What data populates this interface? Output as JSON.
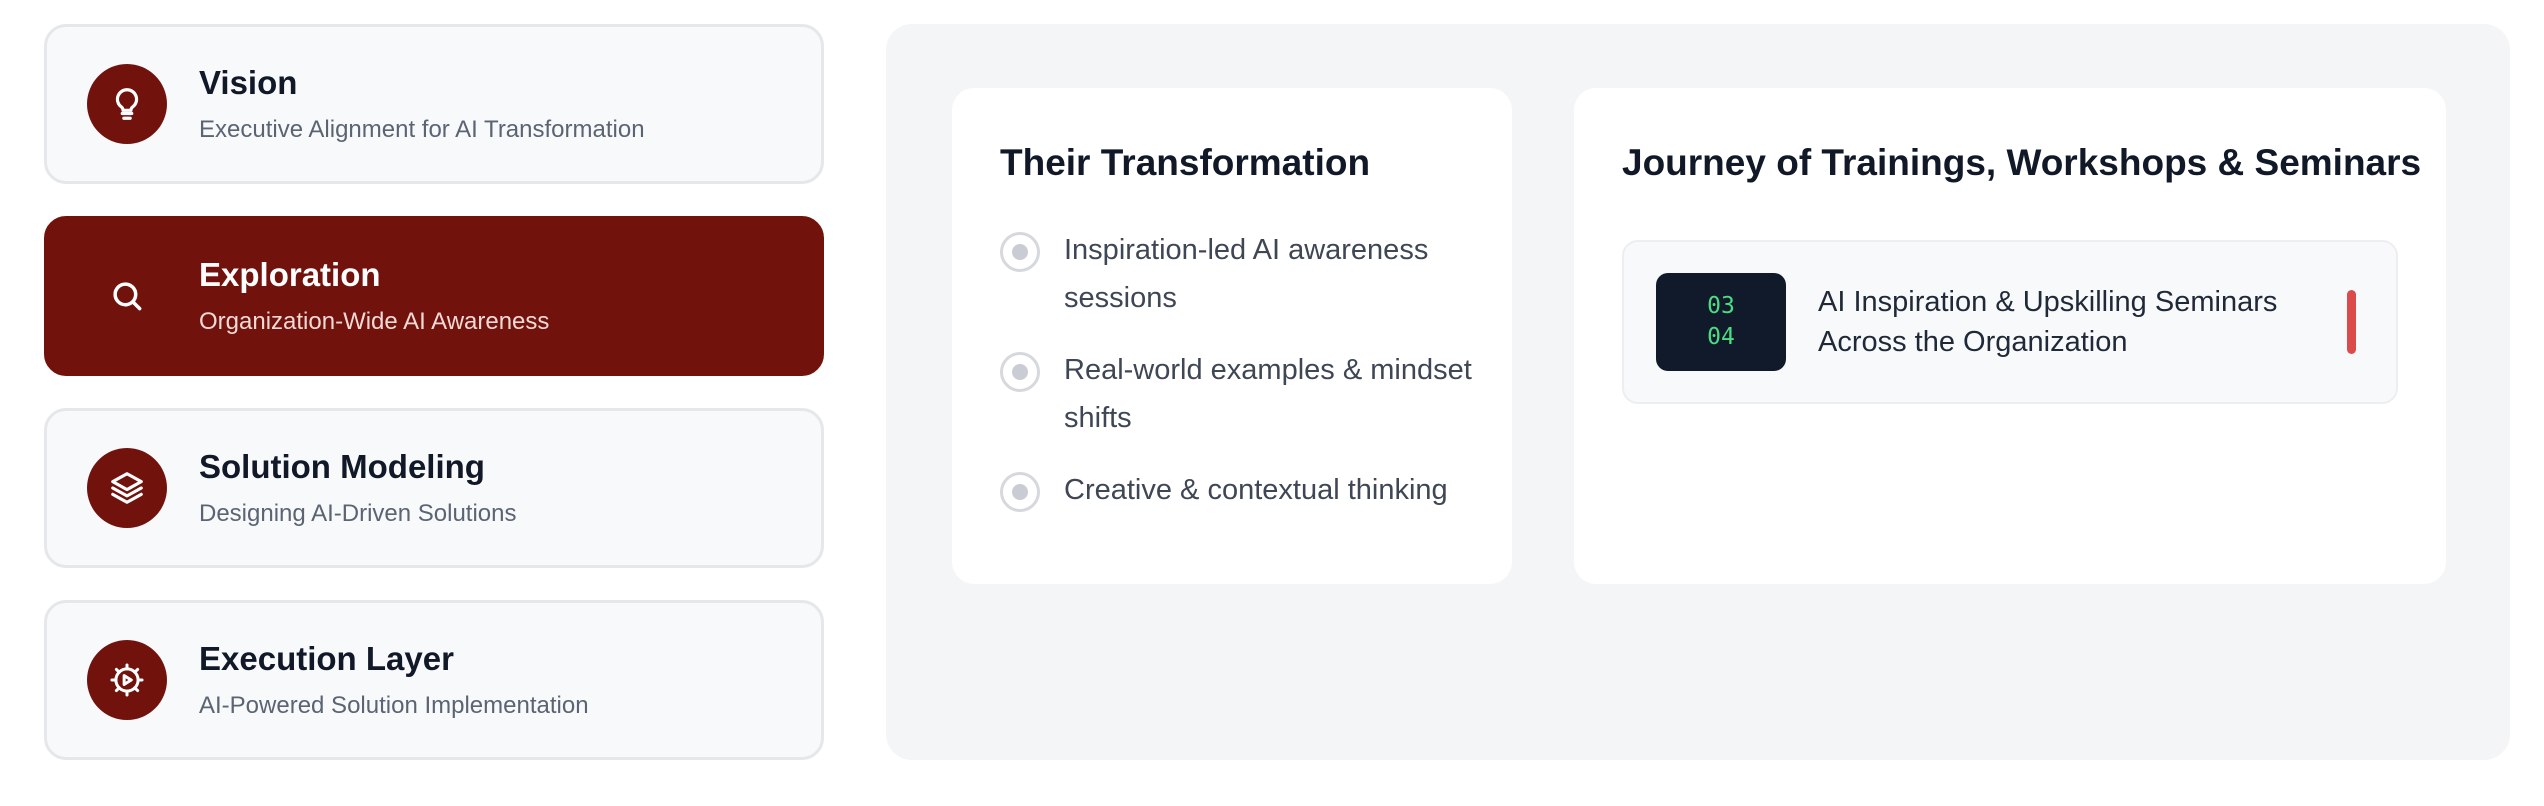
{
  "stages": [
    {
      "title": "Vision",
      "subtitle": "Executive Alignment for AI Transformation",
      "icon": "lightbulb-icon",
      "active": false
    },
    {
      "title": "Exploration",
      "subtitle": "Organization-Wide AI Awareness",
      "icon": "search-icon",
      "active": true
    },
    {
      "title": "Solution Modeling",
      "subtitle": "Designing AI-Driven Solutions",
      "icon": "layers-icon",
      "active": false
    },
    {
      "title": "Execution Layer",
      "subtitle": "AI-Powered Solution Implementation",
      "icon": "gear-play-icon",
      "active": false
    }
  ],
  "transformation": {
    "title": "Their Transformation",
    "items": [
      "Inspiration-led AI awareness sessions",
      "Real-world examples & mindset shifts",
      "Creative & contextual thinking"
    ]
  },
  "journey": {
    "title": "Journey of Trainings, Workshops & Seminars",
    "items": [
      {
        "code_top": "03",
        "code_bottom": "04",
        "text": "AI Inspiration & Upskilling Seminars Across the Organization"
      }
    ]
  },
  "colors": {
    "brand": "#71120c",
    "panel_bg": "#f4f5f7",
    "code_bg": "#111a2b",
    "code_text": "#4ade80",
    "accent_bar": "#dc4b4b"
  }
}
